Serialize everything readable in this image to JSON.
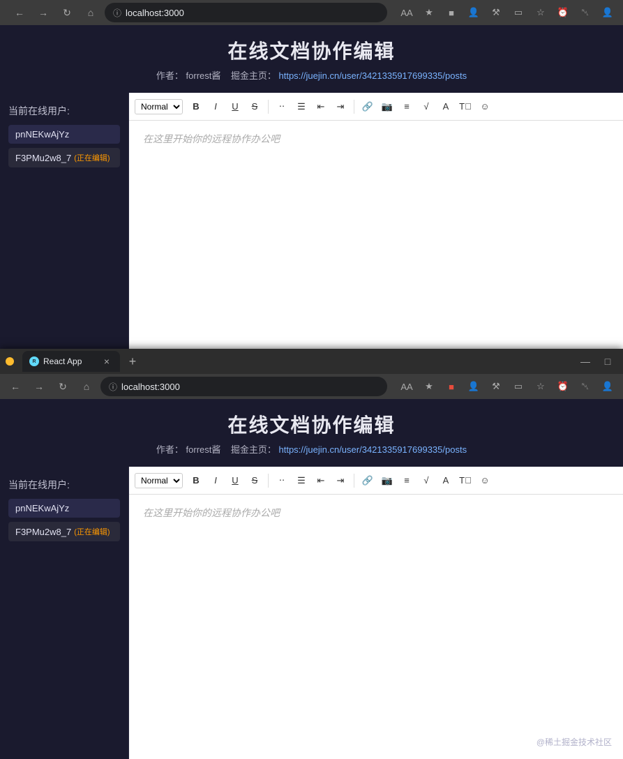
{
  "browser1": {
    "address": "localhost:3000",
    "tab": {
      "title": "React App",
      "close_label": "×",
      "new_tab_label": "+"
    },
    "nav": {
      "back": "←",
      "forward": "→",
      "home": "⌂",
      "reload": "↻"
    }
  },
  "browser2": {
    "address": "localhost:3000",
    "tab": {
      "title": "React App",
      "close_label": "×",
      "new_tab_label": "+"
    }
  },
  "page": {
    "title": "在线文档协作编辑",
    "author_label": "作者：",
    "author": "forrest酱",
    "juejin_label": "掘金主页：",
    "juejin_url": "https://juejin.cn/user/3421335917699335/posts",
    "sidebar_title": "当前在线用户:",
    "users": [
      {
        "name": "pnNEKwAjYz",
        "status": ""
      },
      {
        "name": "F3PMu2w8_7",
        "status": "(正在编辑)"
      }
    ],
    "editor": {
      "placeholder": "在这里开始你的远程协作办公吧",
      "toolbar": {
        "style_select": "Normal",
        "bold": "B",
        "italic": "I",
        "underline": "U",
        "strikethrough": "S"
      }
    },
    "watermark": "@稀土掘金技术社区"
  }
}
